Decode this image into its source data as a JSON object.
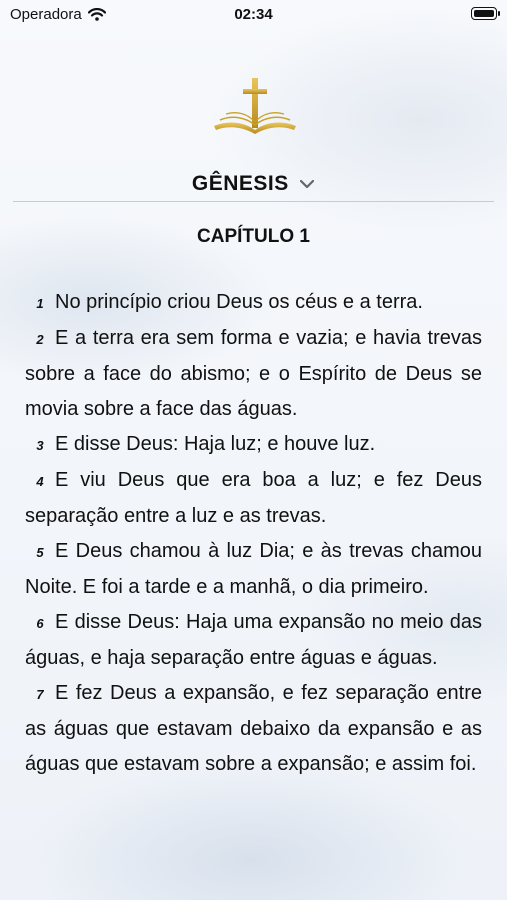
{
  "status_bar": {
    "carrier": "Operadora",
    "time": "02:34"
  },
  "header": {
    "book": "GÊNESIS",
    "chapter": "CAPÍTULO 1"
  },
  "colors": {
    "gold": "#C9A227",
    "text": "#111111"
  },
  "verses": [
    {
      "num": "1",
      "text": "No princípio criou Deus os céus e a terra."
    },
    {
      "num": "2",
      "text": "E a terra era sem forma e vazia; e havia trevas sobre a face do abismo; e o Espírito de Deus se movia sobre a face das águas."
    },
    {
      "num": "3",
      "text": "E disse Deus: Haja luz; e houve luz."
    },
    {
      "num": "4",
      "text": "E viu Deus que era boa a luz; e fez Deus separação entre a luz e as trevas."
    },
    {
      "num": "5",
      "text": "E Deus chamou à luz Dia; e às trevas chamou Noite. E foi a tarde e a manhã, o dia primeiro."
    },
    {
      "num": "6",
      "text": "E disse Deus: Haja uma expansão no meio das águas, e haja separação entre águas e águas."
    },
    {
      "num": "7",
      "text": "E fez Deus a expansão, e fez separação entre as águas que estavam debaixo da expansão e as águas que estavam sobre a expansão; e assim foi."
    }
  ]
}
